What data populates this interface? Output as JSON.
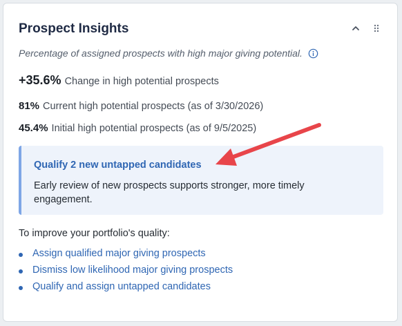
{
  "card": {
    "title": "Prospect Insights",
    "collapse_icon": "chevron-up-icon",
    "drag_icon": "drag-handle-icon"
  },
  "subtitle": {
    "text": "Percentage of assigned prospects with high major giving potential.",
    "info_icon": "info-icon"
  },
  "metrics": [
    {
      "value": "+35.6%",
      "label": "Change in high potential prospects"
    },
    {
      "value": "81%",
      "label": "Current high potential prospects (as of 3/30/2026)"
    },
    {
      "value": "45.4%",
      "label": "Initial high potential prospects (as of 9/5/2025)"
    }
  ],
  "callout": {
    "link": "Qualify 2 new untapped candidates",
    "body": "Early review of new prospects supports stronger, more timely engagement."
  },
  "improve": {
    "heading": "To improve your portfolio's quality:",
    "items": [
      "Assign qualified major giving prospects",
      "Dismiss low likelihood major giving prospects",
      "Qualify and assign untapped candidates"
    ]
  },
  "colors": {
    "link": "#2f66b3",
    "callout_bg": "#eef3fb",
    "callout_border": "#7ea6e6",
    "annotation_arrow": "#e8454a",
    "title": "#1f2a44"
  }
}
